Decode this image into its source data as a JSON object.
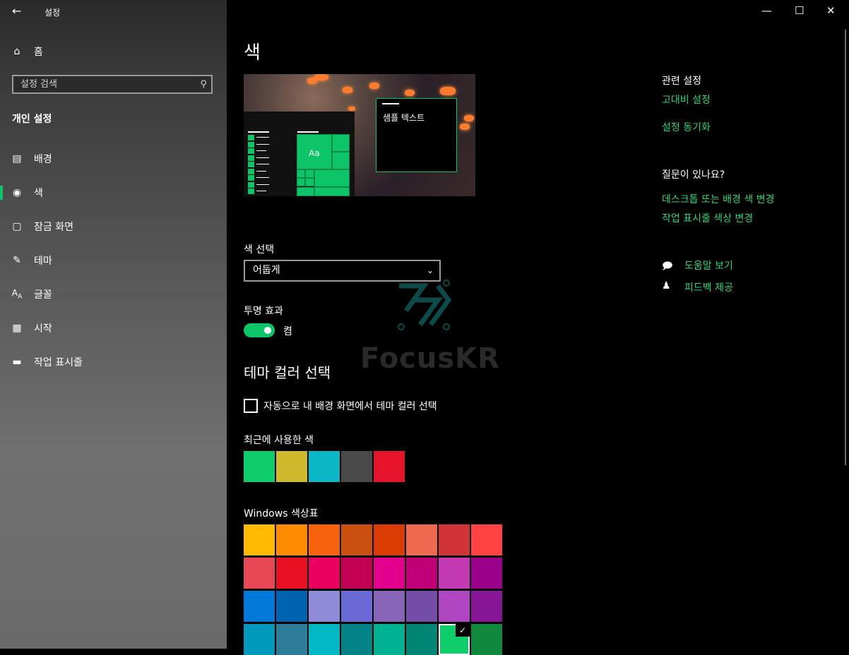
{
  "window": {
    "title": "설정"
  },
  "sidebar": {
    "home": "홈",
    "search_placeholder": "설정 검색",
    "section": "개인 설정",
    "items": [
      {
        "label": "배경",
        "icon": "image-icon"
      },
      {
        "label": "색",
        "icon": "palette-icon",
        "selected": true
      },
      {
        "label": "잠금 화면",
        "icon": "lock-screen-icon"
      },
      {
        "label": "테마",
        "icon": "theme-icon"
      },
      {
        "label": "글꼴",
        "icon": "font-icon"
      },
      {
        "label": "시작",
        "icon": "start-icon"
      },
      {
        "label": "작업 표시줄",
        "icon": "taskbar-icon"
      }
    ]
  },
  "main": {
    "title": "색",
    "preview": {
      "sample_text": "샘플 텍스트",
      "tile_text": "Aa"
    },
    "choose_mode_label": "색 선택",
    "mode_value": "어둡게",
    "transparency_label": "투명 효과",
    "transparency_state": "켬",
    "accent_title": "테마 컬러 선택",
    "auto_accent_label": "자동으로 내 배경 화면에서 테마 컬러 선택",
    "recent_label": "최근에 사용한 색",
    "recent_colors": [
      "#0ecd6a",
      "#cfb92d",
      "#0cb7c5",
      "#4a4a4a",
      "#e6142a"
    ],
    "palette_label": "Windows 색상표",
    "palette": [
      [
        "#ffb900",
        "#ff8c00",
        "#f7630c",
        "#ca5010",
        "#da3b01",
        "#ef6950",
        "#d13438",
        "#ff4343"
      ],
      [
        "#e74856",
        "#e81123",
        "#ea005e",
        "#c30052",
        "#e3008c",
        "#bf0077",
        "#c239b3",
        "#9a0089"
      ],
      [
        "#0078d7",
        "#0063b1",
        "#8e8cd8",
        "#6b69d6",
        "#8764b8",
        "#744da9",
        "#b146c2",
        "#881798"
      ],
      [
        "#0099bc",
        "#2d7d9a",
        "#00b7c3",
        "#038387",
        "#00b294",
        "#018574",
        "#0ecd6a",
        "#10893e"
      ]
    ],
    "selected_color": "#0ecd6a",
    "watermark": "FocusKR"
  },
  "right": {
    "related_title": "관련 설정",
    "related_links": [
      "고대비 설정",
      "설정 동기화"
    ],
    "question_title": "질문이 있나요?",
    "question_links": [
      "데스크톱 또는 배경 색 변경",
      "작업 표시줄 색상 변경"
    ],
    "help_label": "도움말 보기",
    "feedback_label": "피드백 제공"
  },
  "colors": {
    "accent": "#0ec468",
    "link": "#2fd37b"
  }
}
